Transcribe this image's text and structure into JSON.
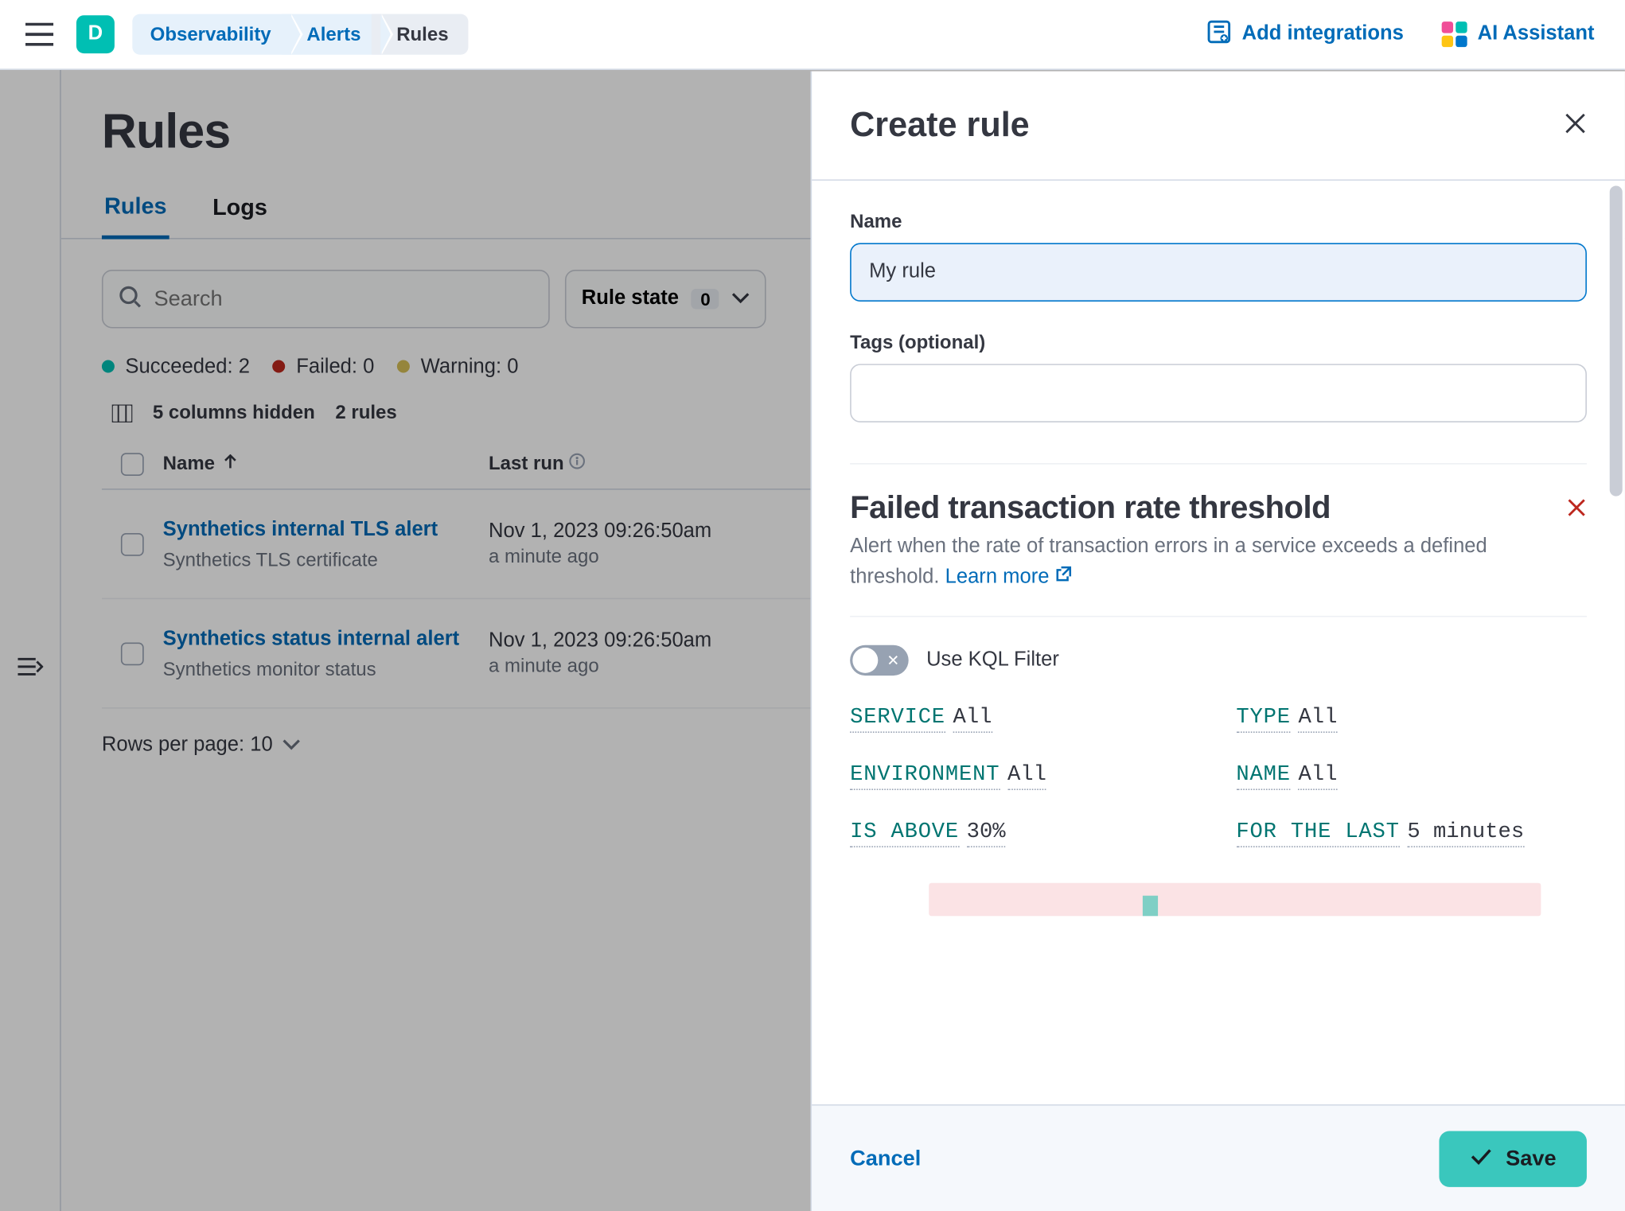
{
  "header": {
    "avatar_initial": "D",
    "breadcrumbs": [
      "Observability",
      "Alerts",
      "Rules"
    ],
    "add_integrations": "Add integrations",
    "ai_assistant": "AI Assistant"
  },
  "page": {
    "title": "Rules",
    "tabs": {
      "rules": "Rules",
      "logs": "Logs"
    },
    "search_placeholder": "Search",
    "state_filter_label": "Rule state",
    "state_filter_count": "0",
    "status": {
      "succeeded_label": "Succeeded:",
      "succeeded_count": "2",
      "failed_label": "Failed:",
      "failed_count": "0",
      "warning_label": "Warning:",
      "warning_count": "0"
    },
    "columns_hidden": "5 columns hidden",
    "rules_count": "2 rules",
    "th_name": "Name",
    "th_last_run": "Last run",
    "pager_label": "Rows per page: 10"
  },
  "rules": [
    {
      "name": "Synthetics internal TLS alert",
      "type": "Synthetics TLS certificate",
      "last_run": "Nov 1, 2023 09:26:50am",
      "relative": "a minute ago"
    },
    {
      "name": "Synthetics status internal alert",
      "type": "Synthetics monitor status",
      "last_run": "Nov 1, 2023 09:26:50am",
      "relative": "a minute ago"
    }
  ],
  "flyout": {
    "title": "Create rule",
    "name_label": "Name",
    "name_value": "My rule",
    "tags_label": "Tags (optional)",
    "rule_type_title": "Failed transaction rate threshold",
    "rule_desc": "Alert when the rate of transaction errors in a service exceeds a defined threshold. ",
    "learn_more": "Learn more",
    "kql_label": "Use KQL Filter",
    "params": {
      "service_k": "SERVICE",
      "service_v": "All",
      "type_k": "TYPE",
      "type_v": "All",
      "env_k": "ENVIRONMENT",
      "env_v": "All",
      "name_k": "NAME",
      "name_v": "All",
      "above_k": "IS ABOVE",
      "above_v": "30%",
      "forlast_k": "FOR THE LAST",
      "forlast_v": "5 minutes"
    },
    "cancel": "Cancel",
    "save": "Save"
  }
}
